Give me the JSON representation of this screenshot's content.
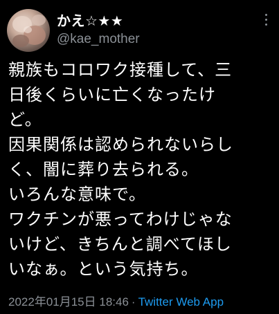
{
  "tweet": {
    "display_name": "かえ☆★★",
    "handle": "@kae_mother",
    "body_lines": [
      "親族もコロワク接種して、三",
      "日後くらいに亡くなったけ",
      "ど。",
      "因果関係は認められないらし",
      "く、闇に葬り去られる。",
      "いろんな意味で。",
      "ワクチンが悪ってわけじゃな",
      "いけど、きちんと調べてほし",
      "いなぁ。という気持ち。"
    ],
    "timestamp": "2022年01月15日 18:46",
    "separator": "·",
    "source": "Twitter Web App",
    "icons": {
      "more": "more-options-icon"
    },
    "colors": {
      "background": "#000000",
      "text": "#ffffff",
      "secondary": "#8b9096",
      "link": "#1d9bf0"
    }
  }
}
